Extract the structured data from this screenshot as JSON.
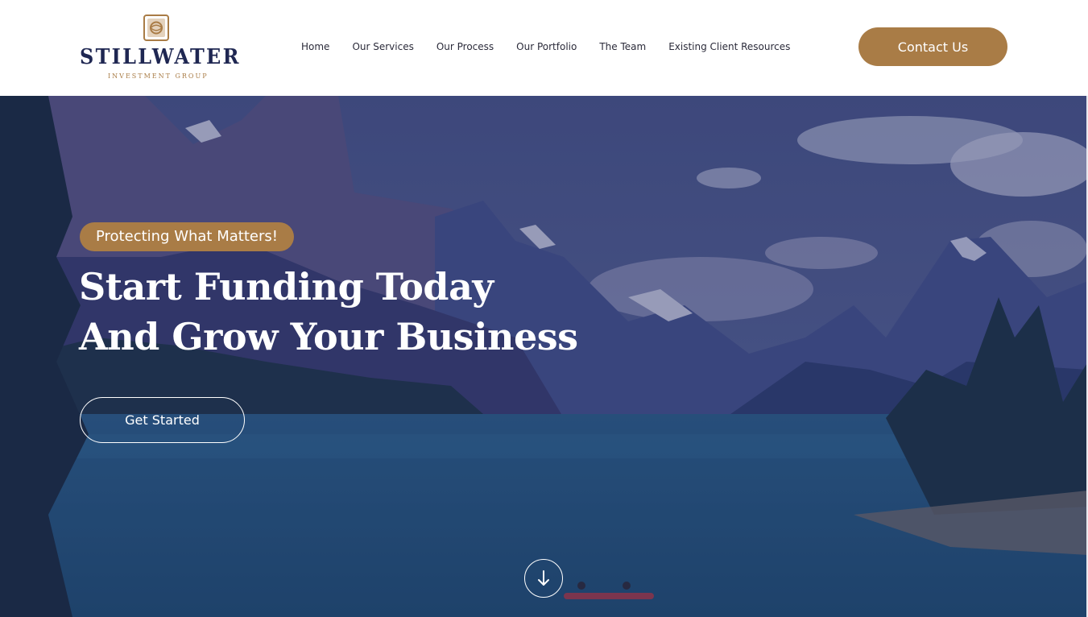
{
  "brand": {
    "name": "STILLWATER",
    "tagline": "INVESTMENT GROUP",
    "accent": "#a97c46",
    "navy": "#1f2752"
  },
  "nav": {
    "items": [
      {
        "label": "Home"
      },
      {
        "label": "Our Services"
      },
      {
        "label": "Our Process"
      },
      {
        "label": "Our Portfolio"
      },
      {
        "label": "The Team"
      },
      {
        "label": "Existing Client Resources"
      }
    ],
    "contact_label": "Contact Us"
  },
  "hero": {
    "badge": "Protecting What Matters!",
    "headline_line1": "Start Funding Today",
    "headline_line2": "And Grow Your Business",
    "cta_label": "Get Started",
    "scroll_icon": "arrow-down-icon"
  }
}
